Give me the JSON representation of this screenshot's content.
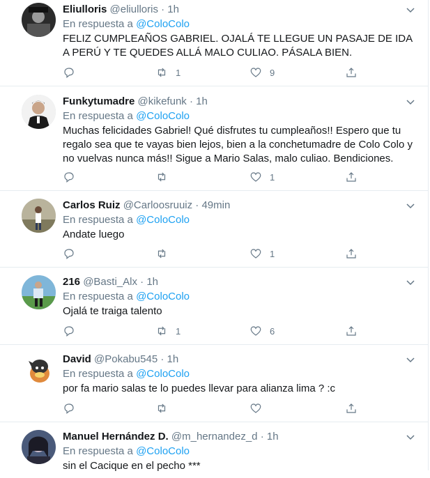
{
  "reply_prefix": "En respuesta a",
  "tweets": [
    {
      "name": "Eliulloris",
      "handle": "@eliulloris",
      "dot": "·",
      "time": "1h",
      "reply_to": "@ColoColo",
      "text": "FELIZ CUMPLEAÑOS GABRIEL. OJALÁ TE LLEGUE UN PASAJE DE IDA A PERÚ Y TE QUEDES ALLÁ MALO CULIAO. PÁSALA BIEN.",
      "replies": "",
      "retweets": "1",
      "likes": "9"
    },
    {
      "name": "Funkytumadre",
      "handle": "@kikefunk",
      "dot": "·",
      "time": "1h",
      "reply_to": "@ColoColo",
      "text": "Muchas felicidades Gabriel! Qué disfrutes tu cumpleaños!! Espero que tu regalo sea que te vayas bien lejos, bien a la conchetumadre de Colo Colo y no vuelvas nunca más!! Sigue a Mario Salas, malo culiao. Bendiciones.",
      "replies": "",
      "retweets": "",
      "likes": "1"
    },
    {
      "name": "Carlos Ruiz",
      "handle": "@Carloosruuiz",
      "dot": "·",
      "time": "49min",
      "reply_to": "@ColoColo",
      "text": "Andate luego",
      "replies": "",
      "retweets": "",
      "likes": "1"
    },
    {
      "name": "216",
      "handle": "@Basti_Alx",
      "dot": "·",
      "time": "1h",
      "reply_to": "@ColoColo",
      "text": "Ojalá te traiga talento",
      "replies": "",
      "retweets": "1",
      "likes": "6"
    },
    {
      "name": "David",
      "handle": "@Pokabu545",
      "dot": "·",
      "time": "1h",
      "reply_to": "@ColoColo",
      "text": "por fa mario salas te lo puedes llevar para alianza lima ? :c",
      "replies": "",
      "retweets": "",
      "likes": ""
    },
    {
      "name": "Manuel Hernández D.",
      "handle": "@m_hernandez_d",
      "dot": "·",
      "time": "1h",
      "reply_to": "@ColoColo",
      "text": "sin el Cacique en el pecho ***",
      "replies": "",
      "retweets": "",
      "likes": ""
    }
  ],
  "icons": {
    "reply": "reply-icon",
    "retweet": "retweet-icon",
    "like": "heart-icon",
    "share": "share-icon",
    "more": "chevron-down-icon"
  },
  "colors": {
    "accent": "#1da1f2",
    "muted": "#657786",
    "divider": "#e6ecf0",
    "text": "#14171a"
  }
}
